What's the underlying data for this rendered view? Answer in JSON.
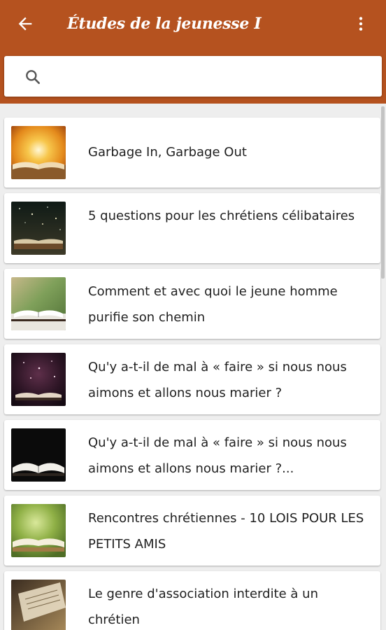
{
  "app": {
    "title": "Études de la jeunesse I",
    "icons": {
      "back": "arrow-left-icon",
      "menu": "more-vert-icon",
      "search": "search-icon"
    },
    "colors": {
      "appbar": "#b5521f",
      "background": "#eeeeee",
      "card": "#ffffff",
      "text": "#1f1f1f"
    }
  },
  "search": {
    "value": "",
    "placeholder": ""
  },
  "articles": [
    {
      "title": "Garbage In, Garbage Out",
      "thumbnail": "sunrise-open-bible"
    },
    {
      "title": "5 questions pour les chrétiens célibataires",
      "thumbnail": "starry-bible"
    },
    {
      "title": "Comment et avec quoi le jeune homme purifie son chemin",
      "thumbnail": "green-bokeh-bible"
    },
    {
      "title": "Qu'y a-t-il de mal à « faire » si nous nous aimons et allons nous marier ?",
      "thumbnail": "purple-sparkle-bible"
    },
    {
      "title": "Qu'y a-t-il de mal à « faire » si nous nous aimons et allons nous marier ?...",
      "thumbnail": "dark-open-bible"
    },
    {
      "title": "Rencontres chrétiennes - 10 LOIS POUR LES PETITS AMIS",
      "thumbnail": "green-leaves-bible"
    },
    {
      "title": "Le genre d'association interdite à un chrétien",
      "thumbnail": "old-page-bible"
    }
  ]
}
